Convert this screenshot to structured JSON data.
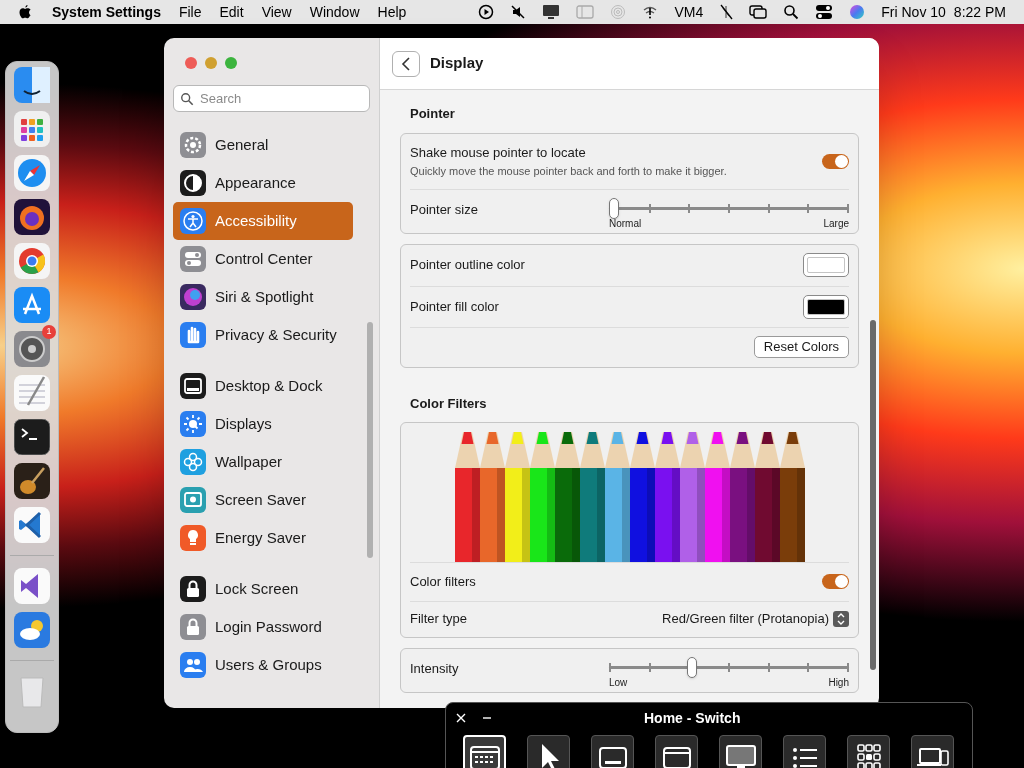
{
  "menu_bar": {
    "app_name": "System Settings",
    "menus": [
      "File",
      "Edit",
      "View",
      "Window",
      "Help"
    ],
    "status_text": "VM4",
    "date": "Fri Nov 10",
    "time": "8:22 PM"
  },
  "dock": {
    "badge": "1"
  },
  "sidebar": {
    "search": {
      "placeholder": "Search"
    },
    "groups": [
      [
        {
          "label": "General",
          "selected": false
        },
        {
          "label": "Appearance",
          "selected": false
        },
        {
          "label": "Accessibility",
          "selected": true
        },
        {
          "label": "Control Center",
          "selected": false
        },
        {
          "label": "Siri & Spotlight",
          "selected": false
        },
        {
          "label": "Privacy & Security",
          "selected": false
        }
      ],
      [
        {
          "label": "Desktop & Dock",
          "selected": false
        },
        {
          "label": "Displays",
          "selected": false
        },
        {
          "label": "Wallpaper",
          "selected": false
        },
        {
          "label": "Screen Saver",
          "selected": false
        },
        {
          "label": "Energy Saver",
          "selected": false
        }
      ],
      [
        {
          "label": "Lock Screen",
          "selected": false
        },
        {
          "label": "Login Password",
          "selected": false
        },
        {
          "label": "Users & Groups",
          "selected": false
        }
      ]
    ]
  },
  "content": {
    "title": "Display",
    "sections": [
      {
        "heading": "Pointer",
        "cards": [
          [
            {
              "kind": "toggle",
              "label": "Shake mouse pointer to locate",
              "description": "Quickly move the mouse pointer back and forth to make it bigger.",
              "on": true
            },
            {
              "kind": "slider",
              "label": "Pointer size",
              "level": 0,
              "min_label": "Normal",
              "max_label": "Large"
            }
          ],
          [
            {
              "kind": "color",
              "label": "Pointer outline color",
              "color": "#ffffff"
            },
            {
              "kind": "color",
              "label": "Pointer fill color",
              "color": "#000000"
            },
            {
              "kind": "button",
              "label": "Reset Colors"
            }
          ]
        ]
      },
      {
        "heading": "Color Filters",
        "cards": [
          [
            {
              "kind": "picture"
            },
            {
              "kind": "toggle",
              "label": "Color filters",
              "on": true
            },
            {
              "kind": "popup",
              "label": "Filter type",
              "value": "Red/Green filter (Protanopia)"
            }
          ],
          [
            {
              "kind": "slider",
              "label": "Intensity",
              "level": 0.34,
              "min_label": "Low",
              "max_label": "High"
            }
          ]
        ]
      }
    ]
  },
  "switch_panel": {
    "title": "Home - Switch",
    "buttons": [
      {
        "selected": true
      },
      {
        "selected": false
      },
      {
        "selected": false
      },
      {
        "selected": false
      },
      {
        "selected": false
      },
      {
        "selected": false
      },
      {
        "selected": false
      },
      {
        "selected": false
      }
    ]
  }
}
